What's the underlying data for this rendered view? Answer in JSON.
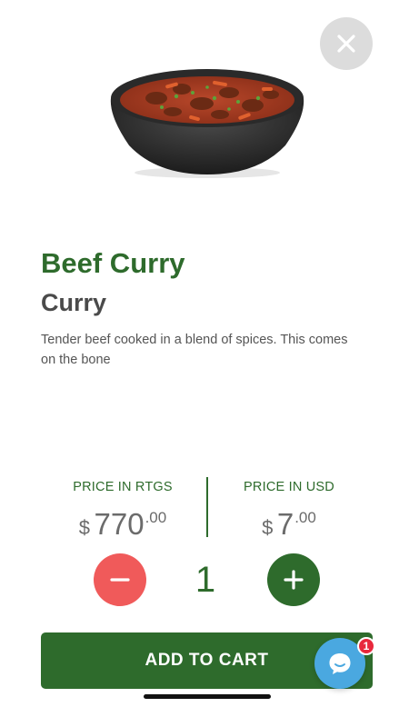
{
  "product": {
    "name": "Beef Curry",
    "category": "Curry",
    "description": "Tender beef cooked in a blend of spices. This comes on the bone"
  },
  "pricing": {
    "rtgs": {
      "label": "PRICE IN RTGS",
      "currency_symbol": "$",
      "amount_int": "770",
      "amount_dec": ".00"
    },
    "usd": {
      "label": "PRICE IN USD",
      "currency_symbol": "$",
      "amount_int": "7",
      "amount_dec": ".00"
    }
  },
  "quantity": {
    "value": "1",
    "decrement_icon": "minus-icon",
    "increment_icon": "plus-icon"
  },
  "cart": {
    "add_label": "ADD TO CART"
  },
  "chat": {
    "icon": "chat-bubble-icon",
    "badge_count": "1"
  },
  "close": {
    "icon": "close-icon"
  },
  "colors": {
    "brand_green": "#2e6b2c",
    "minus_red": "#f05a5a",
    "chat_blue": "#4aa8e0",
    "badge_red": "#e8283c",
    "close_gray": "#dcdcdc"
  }
}
